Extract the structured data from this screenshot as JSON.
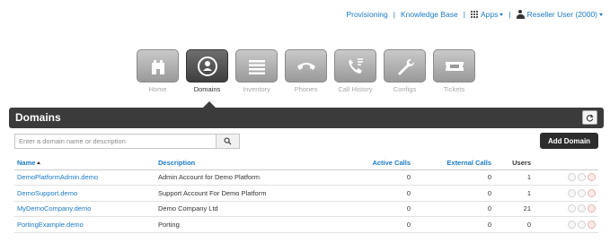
{
  "topnav": {
    "provisioning": "Provisioning",
    "knowledge_base": "Knowledge Base",
    "apps": "Apps",
    "user": "Reseller User (2000)"
  },
  "tiles": [
    {
      "label": "Home",
      "icon": "home-icon"
    },
    {
      "label": "Domains",
      "icon": "domains-icon",
      "active": true
    },
    {
      "label": "Inventory",
      "icon": "inventory-icon"
    },
    {
      "label": "Phones",
      "icon": "phone-icon"
    },
    {
      "label": "Call History",
      "icon": "call-history-icon"
    },
    {
      "label": "Configs",
      "icon": "wrench-icon"
    },
    {
      "label": "Tickets",
      "icon": "ticket-icon"
    }
  ],
  "header": {
    "title": "Domains"
  },
  "search": {
    "placeholder": "Enter a domain name or description"
  },
  "add_button": "Add Domain",
  "table": {
    "columns": {
      "name": "Name",
      "description": "Description",
      "active_calls": "Active Calls",
      "external_calls": "External Calls",
      "users": "Users"
    },
    "rows": [
      {
        "name": "DemoPlatformAdmin.demo",
        "description": "Admin Account for Demo Platform",
        "active_calls": "0",
        "external_calls": "0",
        "users": "1"
      },
      {
        "name": "DemoSupport.demo",
        "description": "Support Account For Demo Platform",
        "active_calls": "0",
        "external_calls": "0",
        "users": "1"
      },
      {
        "name": "MyDemoCompany.demo",
        "description": "Demo Company Ltd",
        "active_calls": "0",
        "external_calls": "0",
        "users": "21"
      },
      {
        "name": "PortingExample.demo",
        "description": "Porting",
        "active_calls": "0",
        "external_calls": "0",
        "users": "0"
      }
    ]
  },
  "colors": {
    "link": "#1a7ac6",
    "header_bar": "#3b3b3b",
    "tile_active": "#4a4a4a",
    "tile_inactive": "#b0b0b0"
  }
}
